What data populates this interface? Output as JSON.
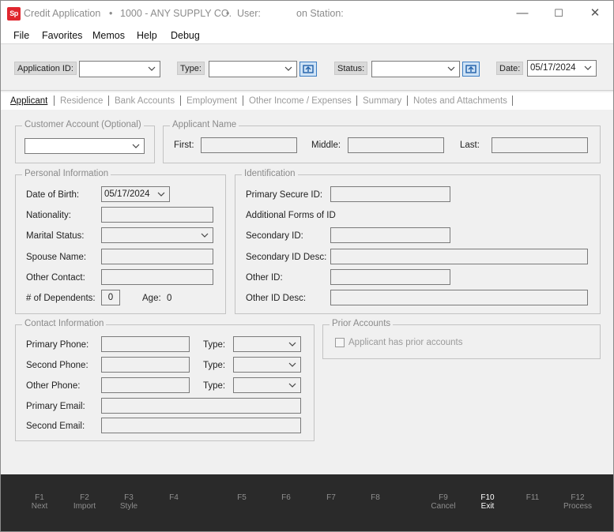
{
  "title": {
    "app_name": "Credit Application",
    "separator": "•",
    "company": "1000 - ANY SUPPLY CO.",
    "user_label": "User:",
    "station_label": "on Station:",
    "logo_text": "Sp"
  },
  "window_controls": {
    "minimize": "—",
    "maximize": "☐",
    "close": "✕"
  },
  "menu": [
    "File",
    "Favorites",
    "Memos",
    "Help",
    "Debug"
  ],
  "toolbar": {
    "application_id_label": "Application ID:",
    "application_id_value": "",
    "type_label": "Type:",
    "type_value": "",
    "status_label": "Status:",
    "status_value": "",
    "date_label": "Date:",
    "date_value": "05/17/2024"
  },
  "tabs": [
    "Applicant",
    "Residence",
    "Bank Accounts",
    "Employment",
    "Other Income / Expenses",
    "Summary",
    "Notes and Attachments"
  ],
  "customer_account": {
    "legend": "Customer Account (Optional)",
    "value": ""
  },
  "applicant_name": {
    "legend": "Applicant Name",
    "first_label": "First:",
    "first_value": "",
    "middle_label": "Middle:",
    "middle_value": "",
    "last_label": "Last:",
    "last_value": ""
  },
  "personal": {
    "legend": "Personal Information",
    "dob_label": "Date of Birth:",
    "dob_value": "05/17/2024",
    "nationality_label": "Nationality:",
    "nationality_value": "",
    "marital_label": "Marital Status:",
    "marital_value": "",
    "spouse_label": "Spouse Name:",
    "spouse_value": "",
    "other_contact_label": "Other Contact:",
    "other_contact_value": "",
    "dependents_label": "# of Dependents:",
    "dependents_value": "0",
    "age_label": "Age:",
    "age_value": "0"
  },
  "identification": {
    "legend": "Identification",
    "primary_label": "Primary Secure ID:",
    "primary_value": "",
    "additional_label": "Additional Forms of ID",
    "secondary_label": "Secondary ID:",
    "secondary_value": "",
    "secondary_desc_label": "Secondary ID Desc:",
    "secondary_desc_value": "",
    "other_label": "Other ID:",
    "other_value": "",
    "other_desc_label": "Other ID Desc:",
    "other_desc_value": ""
  },
  "contact": {
    "legend": "Contact Information",
    "primary_phone_label": "Primary Phone:",
    "second_phone_label": "Second Phone:",
    "other_phone_label": "Other Phone:",
    "type_label": "Type:",
    "primary_email_label": "Primary Email:",
    "second_email_label": "Second Email:"
  },
  "prior_accounts": {
    "legend": "Prior Accounts",
    "checkbox_label": "Applicant has prior accounts"
  },
  "fkeys": [
    {
      "key": "F1",
      "label": "Next"
    },
    {
      "key": "F2",
      "label": "Import"
    },
    {
      "key": "F3",
      "label": "Style"
    },
    {
      "key": "F4",
      "label": ""
    },
    {
      "key": "F5",
      "label": ""
    },
    {
      "key": "F6",
      "label": ""
    },
    {
      "key": "F7",
      "label": ""
    },
    {
      "key": "F8",
      "label": ""
    },
    {
      "key": "F9",
      "label": "Cancel"
    },
    {
      "key": "F10",
      "label": "Exit"
    },
    {
      "key": "F11",
      "label": ""
    },
    {
      "key": "F12",
      "label": "Process"
    }
  ],
  "colors": {
    "accent": "#e0262e",
    "function_bar": "#2a2a2a",
    "picker": "#3b7dc2"
  }
}
